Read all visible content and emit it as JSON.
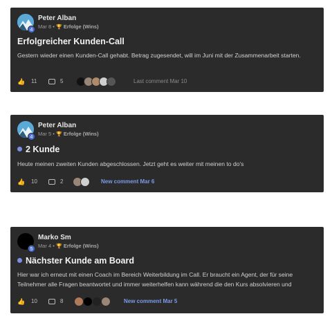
{
  "posts": [
    {
      "author": "Peter Alban",
      "level": "4",
      "date": "Mar 8",
      "separator": "•",
      "category": "Erfolge (Wins)",
      "title": "Erfolgreicher Kunden-Call",
      "unread": false,
      "body": "Gestern wieder einen Kunden-Call gehabt. Betrag zugesendet, will im Juni mit der Zusammenarbeit starten.",
      "likes": "11",
      "comments": "5",
      "comment_status": "Last comment Mar 10"
    },
    {
      "author": "Peter Alban",
      "level": "4",
      "date": "Mar 5",
      "separator": "•",
      "category": "Erfolge (Wins)",
      "title": "2 Kunde",
      "unread": true,
      "body": "Heute meinen zweiten Kunden abgeschlossen. Jetzt geht es weiter mit meinen to do's",
      "likes": "10",
      "comments": "2",
      "comment_status": "New comment Mar 6"
    },
    {
      "author": "Marko Sm",
      "level": "5",
      "date": "Mar 4",
      "separator": "•",
      "category": "Erfolge (Wins)",
      "title": "Nächster Kunde am Board",
      "unread": true,
      "body": "Hier war ich erneut mit einen Coach im Bereich Weiterbildung im Call. Er braucht ein Agent, der für seine Teilnehmer alle Fragen beantwortet und immer weiterhelfen kann während die den Kurs absolvieren und",
      "likes": "10",
      "comments": "8",
      "comment_status": "New comment Mar 5"
    }
  ],
  "icons": {
    "like": "thumbs-up-icon",
    "comment": "comment-icon",
    "category": "trophy-icon"
  },
  "colors": {
    "card": "#2b2b2b",
    "accent": "#7b9be6",
    "unread_dot": "#7b8fe0",
    "level_badge": "#4a6fd6",
    "trophy": "#e0a800"
  }
}
